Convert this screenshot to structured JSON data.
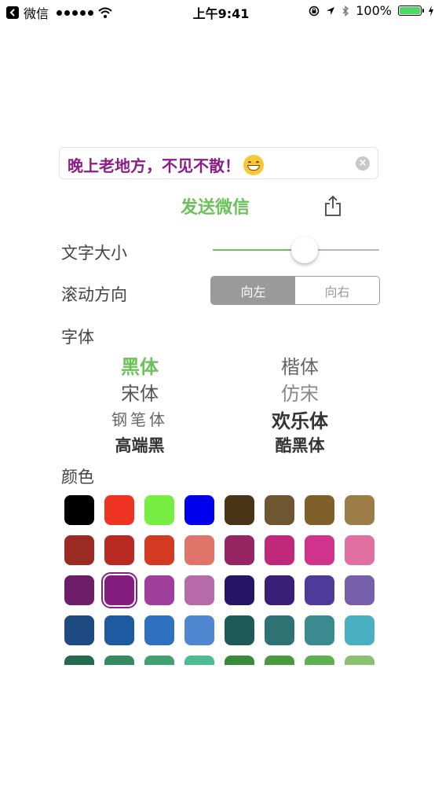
{
  "status_bar": {
    "back_app": "微信",
    "time": "上午9:41",
    "battery": "100%"
  },
  "message": {
    "value": "晚上老地方，不见不散！",
    "emoji": "grinning-face"
  },
  "send_button": "发送微信",
  "font_size": {
    "label": "文字大小",
    "value": 0.55
  },
  "scroll_direction": {
    "label": "滚动方向",
    "options": [
      "向左",
      "向右"
    ],
    "selected": "向左"
  },
  "fonts": {
    "label": "字体",
    "options": [
      "黑体",
      "楷体",
      "宋体",
      "仿宋",
      "钢笔体",
      "欢乐体",
      "高端黑",
      "酷黑体"
    ],
    "selected": "黑体"
  },
  "colors": {
    "label": "颜色",
    "swatches": [
      [
        "#000000",
        "#ee3322",
        "#77ee44",
        "#0000ee",
        "#4a3418",
        "#6e5631",
        "#80602a",
        "#9c7d47"
      ],
      [
        "#9a2a22",
        "#b82a22",
        "#d23a22",
        "#e07468",
        "#962563",
        "#c0287a",
        "#d0338c",
        "#e070a0"
      ],
      [
        "#6e1d68",
        "#851d80",
        "#a03e9c",
        "#b66aa8",
        "#241565",
        "#3a1f78",
        "#4e3a98",
        "#7660ac"
      ],
      [
        "#1e4a82",
        "#1e5aa0",
        "#3070c0",
        "#4f88d0",
        "#1e5a58",
        "#2f7274",
        "#3a8a90",
        "#48b0c0"
      ],
      [
        "#266a50",
        "#358a60",
        "#40a070",
        "#4ebc92",
        "#3a8a3c",
        "#4a9a40",
        "#5eb050",
        "#8ac070"
      ]
    ],
    "selected_row": 2,
    "selected_col": 1
  }
}
